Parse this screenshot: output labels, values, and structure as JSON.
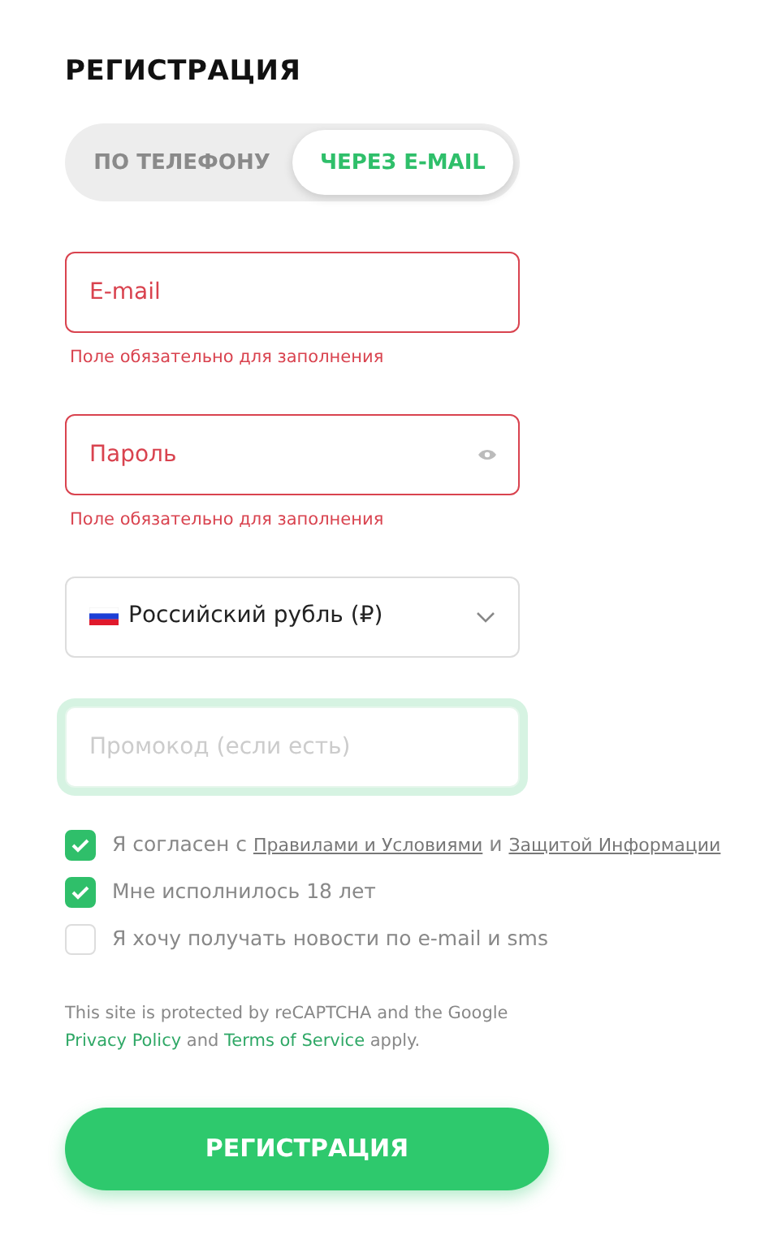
{
  "title": "РЕГИСТРАЦИЯ",
  "tabs": [
    {
      "label": "ПО ТЕЛЕФОНУ",
      "selected": false
    },
    {
      "label": "ЧЕРЕЗ E-MAIL",
      "selected": true
    }
  ],
  "fields": [
    {
      "kind": "text",
      "placeholder": "E-mail",
      "invalid": true,
      "error": "Поле обязательно для заполнения"
    },
    {
      "kind": "password",
      "placeholder": "Пароль",
      "invalid": true,
      "error": "Поле обязательно для заполнения"
    },
    {
      "kind": "select",
      "value": "Российский рубль (₽)"
    },
    {
      "kind": "text",
      "placeholder": "Промокод (если есть)",
      "focused": true
    }
  ],
  "checkboxes": [
    {
      "checked": true,
      "parts": [
        {
          "text": "Я согласен с "
        },
        {
          "link": "Правилами и Условиями"
        },
        {
          "text": " и "
        },
        {
          "link": "Защитой Информации"
        }
      ]
    },
    {
      "checked": true,
      "parts": [
        {
          "text": "Мне исполнилось 18 лет"
        }
      ]
    },
    {
      "checked": false,
      "parts": [
        {
          "text": "Я хочу получать новости по e-mail и sms"
        }
      ]
    }
  ],
  "captcha": [
    {
      "text": "This site is protected by reCAPTCHA and the Google "
    },
    {
      "link": "Privacy Policy"
    },
    {
      "text": " and "
    },
    {
      "link": "Terms of Service"
    },
    {
      "text": " apply."
    }
  ],
  "submit": "РЕГИСТРАЦИЯ"
}
